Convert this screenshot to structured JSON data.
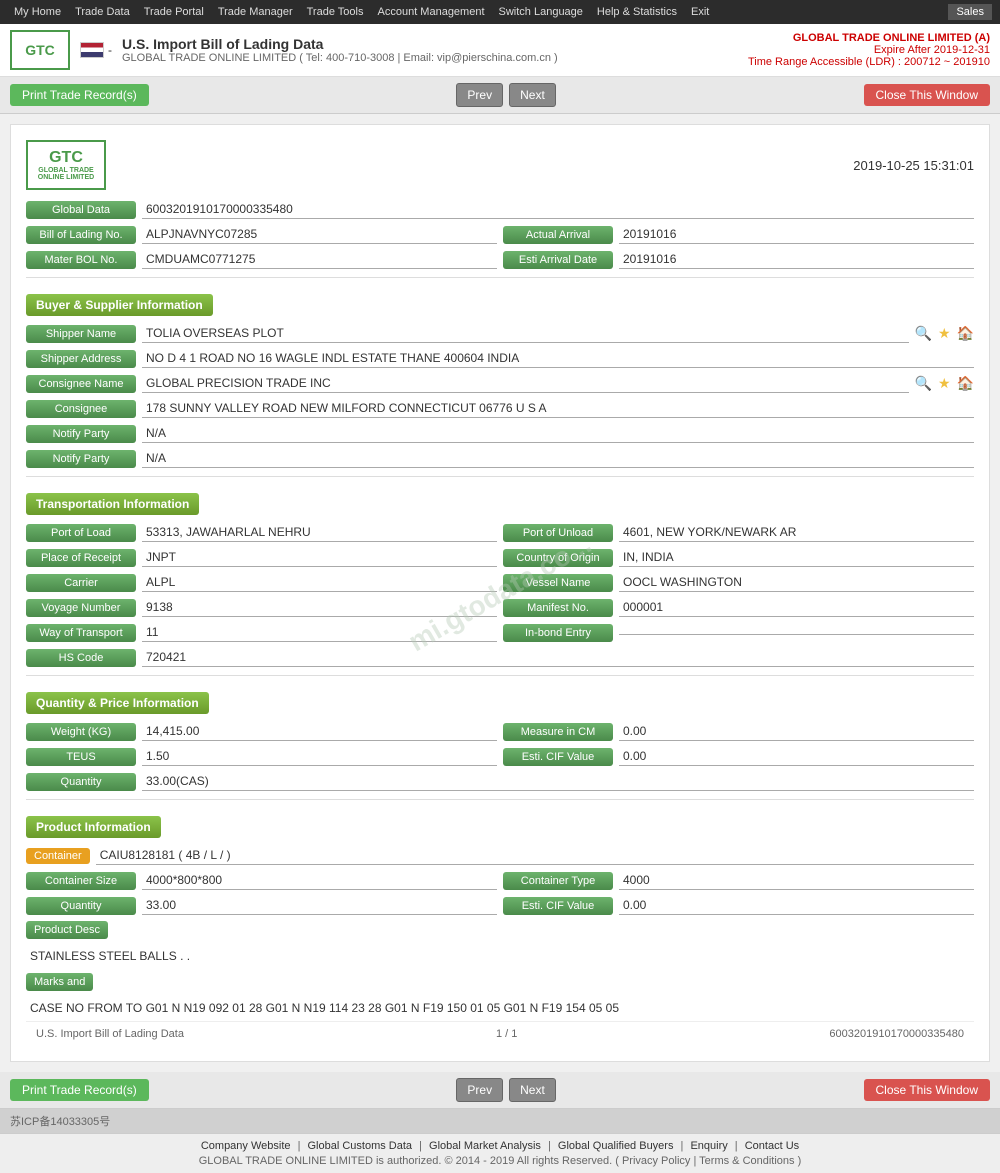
{
  "nav": {
    "items": [
      "My Home",
      "Trade Data",
      "Trade Portal",
      "Trade Manager",
      "Trade Tools",
      "Account Management",
      "Switch Language",
      "Help & Statistics",
      "Exit"
    ],
    "sales": "Sales"
  },
  "header": {
    "logo_text": "GTC",
    "logo_sub": "GLOBAL TRADE ONLINE LIMITED",
    "title": "U.S. Import Bill of Lading Data",
    "company_line": "GLOBAL TRADE ONLINE LIMITED ( Tel: 400-710-3008 | Email: vip@pierschina.com.cn )",
    "right_company": "GLOBAL TRADE ONLINE LIMITED (A)",
    "right_expire": "Expire After 2019-12-31",
    "right_range": "Time Range Accessible (LDR) : 200712 ~ 201910"
  },
  "toolbar": {
    "print_label": "Print Trade Record(s)",
    "prev_label": "Prev",
    "next_label": "Next",
    "close_label": "Close This Window"
  },
  "record": {
    "datetime": "2019-10-25 15:31:01",
    "global_data_label": "Global Data",
    "global_data_value": "6003201910170000335480",
    "bol_label": "Bill of Lading No.",
    "bol_value": "ALPJNAVNYC07285",
    "actual_arrival_label": "Actual Arrival",
    "actual_arrival_value": "20191016",
    "master_bol_label": "Mater BOL No.",
    "master_bol_value": "CMDUAMC0771275",
    "esti_arrival_label": "Esti Arrival Date",
    "esti_arrival_value": "20191016"
  },
  "buyer_supplier": {
    "section_title": "Buyer & Supplier Information",
    "shipper_name_label": "Shipper Name",
    "shipper_name_value": "TOLIA OVERSEAS PLOT",
    "shipper_address_label": "Shipper Address",
    "shipper_address_value": "NO D 4 1 ROAD NO 16 WAGLE INDL ESTATE THANE 400604 INDIA",
    "consignee_name_label": "Consignee Name",
    "consignee_name_value": "GLOBAL PRECISION TRADE INC",
    "consignee_label": "Consignee",
    "consignee_value": "178 SUNNY VALLEY ROAD NEW MILFORD CONNECTICUT 06776 U S A",
    "notify_party1_label": "Notify Party",
    "notify_party1_value": "N/A",
    "notify_party2_label": "Notify Party",
    "notify_party2_value": "N/A"
  },
  "transport": {
    "section_title": "Transportation Information",
    "port_load_label": "Port of Load",
    "port_load_value": "53313, JAWAHARLAL NEHRU",
    "port_unload_label": "Port of Unload",
    "port_unload_value": "4601, NEW YORK/NEWARK AR",
    "place_receipt_label": "Place of Receipt",
    "place_receipt_value": "JNPT",
    "country_origin_label": "Country of Origin",
    "country_origin_value": "IN, INDIA",
    "carrier_label": "Carrier",
    "carrier_value": "ALPL",
    "vessel_name_label": "Vessel Name",
    "vessel_name_value": "OOCL WASHINGTON",
    "voyage_label": "Voyage Number",
    "voyage_value": "9138",
    "manifest_label": "Manifest No.",
    "manifest_value": "000001",
    "way_transport_label": "Way of Transport",
    "way_transport_value": "11",
    "inbond_label": "In-bond Entry",
    "inbond_value": "",
    "hs_code_label": "HS Code",
    "hs_code_value": "720421"
  },
  "quantity_price": {
    "section_title": "Quantity & Price Information",
    "weight_label": "Weight (KG)",
    "weight_value": "14,415.00",
    "measure_label": "Measure in CM",
    "measure_value": "0.00",
    "teus_label": "TEUS",
    "teus_value": "1.50",
    "esti_cif_label": "Esti. CIF Value",
    "esti_cif_value": "0.00",
    "quantity_label": "Quantity",
    "quantity_value": "33.00(CAS)"
  },
  "product": {
    "section_title": "Product Information",
    "container_badge": "Container",
    "container_value": "CAIU8128181 ( 4B / L / )",
    "container_size_label": "Container Size",
    "container_size_value": "4000*800*800",
    "container_type_label": "Container Type",
    "container_type_value": "4000",
    "quantity_label": "Quantity",
    "quantity_value": "33.00",
    "esti_cif_label": "Esti. CIF Value",
    "esti_cif_value": "0.00",
    "product_desc_label": "Product Desc",
    "product_desc_value": "STAINLESS STEEL BALLS . .",
    "marks_label": "Marks and",
    "marks_value": "CASE NO FROM TO G01 N N19 092 01 28 G01 N N19 114 23 28 G01 N F19 150 01 05 G01 N F19 154 05 05"
  },
  "record_footer": {
    "label": "U.S. Import Bill of Lading Data",
    "page": "1 / 1",
    "record_id": "6003201910170000335480"
  },
  "footer": {
    "links": [
      "Company Website",
      "Global Customs Data",
      "Global Market Analysis",
      "Global Qualified Buyers",
      "Enquiry",
      "Contact Us"
    ],
    "copyright": "GLOBAL TRADE ONLINE LIMITED is authorized. © 2014 - 2019 All rights Reserved.  (  Privacy Policy  |  Terms & Conditions  )",
    "icp": "苏ICP备14033305号"
  },
  "watermark": "mi.gtodata.co..."
}
